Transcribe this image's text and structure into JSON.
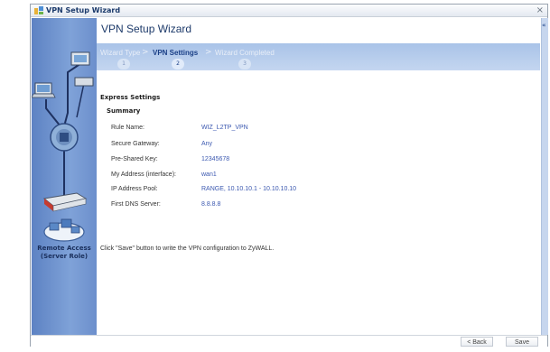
{
  "window": {
    "title": "VPN Setup Wizard",
    "close_glyph": "×"
  },
  "sidebar": {
    "role_line1": "Remote Access",
    "role_line2": "(Server Role)"
  },
  "main": {
    "heading": "VPN Setup Wizard",
    "steps": [
      {
        "label": "Wizard Type",
        "number": "1",
        "active": false
      },
      {
        "label": "VPN Settings",
        "number": "2",
        "active": true
      },
      {
        "label": "Wizard Completed",
        "number": "3",
        "active": false
      }
    ],
    "step_separator": ">",
    "section_title": "Express Settings",
    "summary_title": "Summary",
    "rows": [
      {
        "label": "Rule Name:",
        "value": "WIZ_L2TP_VPN"
      },
      {
        "label": "Secure Gateway:",
        "value": "Any"
      },
      {
        "label": "Pre-Shared Key:",
        "value": "12345678"
      },
      {
        "label": "My Address (interface):",
        "value": "wan1"
      },
      {
        "label": "IP Address Pool:",
        "value": "RANGE, 10.10.10.1 - 10.10.10.10"
      },
      {
        "label": "First DNS Server:",
        "value": "8.8.8.8"
      }
    ],
    "note": "Click \"Save\" button to write the VPN configuration to ZyWALL."
  },
  "collapse_glyph": "«",
  "footer": {
    "back_label": "< Back",
    "save_label": "Save"
  },
  "colors": {
    "accent": "#1a3f86",
    "value_text": "#3b58b0",
    "sidebar": "#6c8fcc"
  },
  "icons": [
    "wizard-app-icon",
    "close-icon",
    "network-diagram-icon",
    "collapse-panel-icon"
  ]
}
